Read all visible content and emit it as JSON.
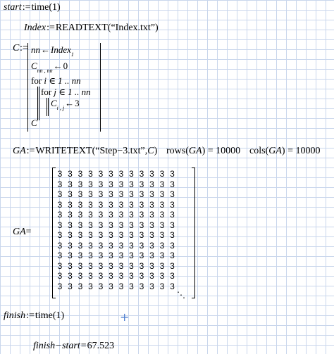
{
  "start": {
    "var": "start",
    "def": ":=",
    "func": "time",
    "arg": "1"
  },
  "index": {
    "var": "Index",
    "def": ":=",
    "func": "READTEXT",
    "arg": "“Index.txt”"
  },
  "program": {
    "var": "C",
    "def": ":=",
    "line1": {
      "var": "nn",
      "arrow": "←",
      "val": "Index",
      "sub": "1"
    },
    "line2": {
      "var": "C",
      "sub": "nn , nn",
      "arrow": "←",
      "val": "0"
    },
    "line3": {
      "kw": "for",
      "var": "i",
      "in": "∈",
      "range": "1 .. nn"
    },
    "line4": {
      "kw": "for",
      "var": "j",
      "in": "∈",
      "range": "1 .. nn"
    },
    "line5": {
      "var": "C",
      "sub": "i , j",
      "arrow": "←",
      "val": "3"
    },
    "line6": {
      "var": "C"
    }
  },
  "write": {
    "var": "GA",
    "def": ":=",
    "func": "WRITETEXT",
    "arg1": "“Step−3.txt”",
    "arg2": "C",
    "rows_func": "rows",
    "rows_arg": "GA",
    "rows_val": "10000",
    "cols_func": "cols",
    "cols_arg": "GA",
    "cols_val": "10000"
  },
  "matrix": {
    "label": "GA",
    "eq": "=",
    "rows": 12,
    "cols": 12,
    "value": "3",
    "ellipsis": "⋱"
  },
  "finish": {
    "var": "finish",
    "def": ":=",
    "func": "time",
    "arg": "1"
  },
  "elapsed": {
    "a": "finish",
    "minus": "−",
    "b": "start",
    "eq": "=",
    "val": "67.523"
  },
  "cursor": {
    "glyph": "+",
    "color": "#4f7fd0"
  },
  "grid_color": "#c9d6ec"
}
